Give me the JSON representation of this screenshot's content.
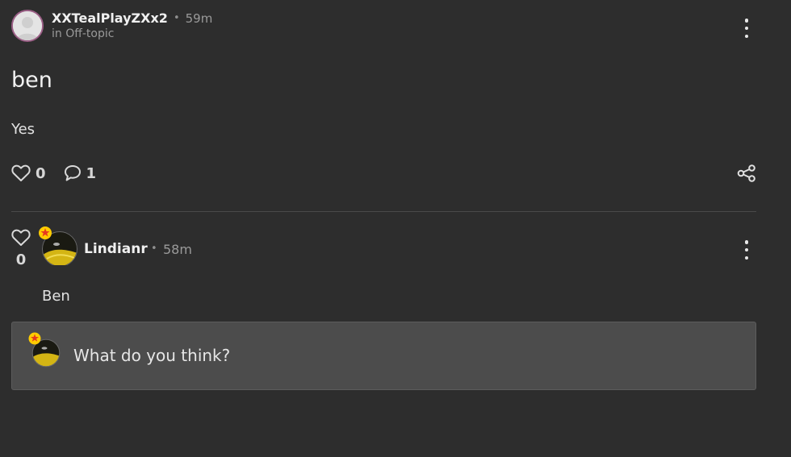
{
  "post": {
    "author": "XXTealPlayZXx2",
    "separator": "•",
    "time": "59m",
    "community": "in Off-topic",
    "title": "ben",
    "body": "Yes",
    "likes": "0",
    "comments": "1",
    "avatar_icon": "default-user-avatar",
    "menu_icon": "kebab-menu-icon",
    "share_icon": "share-icon"
  },
  "comment": {
    "author": "Lindianr",
    "separator": "•",
    "time": "58m",
    "text": "Ben",
    "likes": "0",
    "menu_icon": "kebab-menu-icon"
  },
  "reply": {
    "placeholder": "What do you think?"
  },
  "colors": {
    "background": "#2d2d2d",
    "reply_box": "#4c4c4c",
    "avatar_border": "#9b5f86",
    "badge": "#ffcc00",
    "badge_star": "#e53a1f"
  }
}
